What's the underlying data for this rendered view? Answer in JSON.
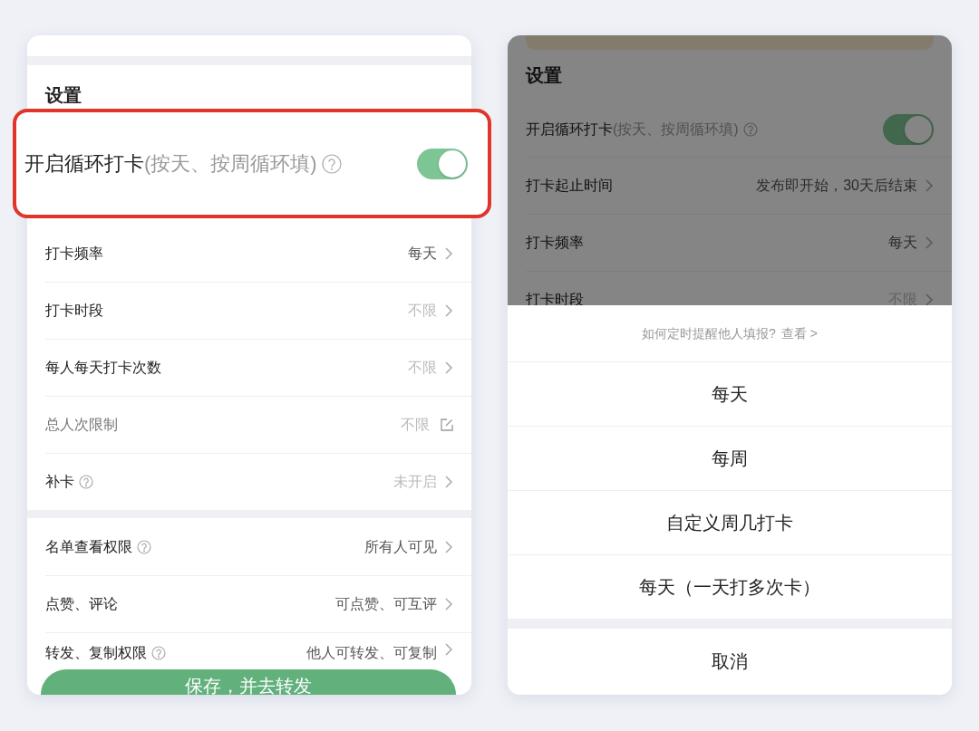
{
  "left_panel": {
    "section_title": "设置",
    "recurring": {
      "label": "开启循环打卡",
      "hint": "(按天、按周循环填)",
      "help": true,
      "on": true,
      "highlighted": true
    },
    "groups": [
      {
        "rows": [
          {
            "label": "打卡频率",
            "value": "每天",
            "kind": "chevron",
            "help": false,
            "value_muted": false,
            "label_muted": false
          },
          {
            "label": "打卡时段",
            "value": "不限",
            "kind": "chevron",
            "help": false,
            "value_muted": true,
            "label_muted": false
          },
          {
            "label": "每人每天打卡次数",
            "value": "不限",
            "kind": "chevron",
            "help": false,
            "value_muted": true,
            "label_muted": false
          },
          {
            "label": "总人次限制",
            "value": "不限",
            "kind": "edit",
            "help": false,
            "value_muted": true,
            "label_muted": true
          },
          {
            "label": "补卡",
            "value": "未开启",
            "kind": "chevron",
            "help": true,
            "value_muted": true,
            "label_muted": false
          }
        ]
      },
      {
        "rows": [
          {
            "label": "名单查看权限",
            "value": "所有人可见",
            "kind": "chevron",
            "help": true,
            "value_muted": false,
            "label_muted": false
          },
          {
            "label": "点赞、评论",
            "value": "可点赞、可互评",
            "kind": "chevron",
            "help": false,
            "value_muted": false,
            "label_muted": false
          },
          {
            "label": "转发、复制权限",
            "value": "他人可转发、可复制",
            "kind": "chevron",
            "help": true,
            "value_muted": false,
            "label_muted": false
          }
        ]
      }
    ],
    "save_button": "保存，并去转发"
  },
  "right_panel": {
    "section_title": "设置",
    "recurring": {
      "label": "开启循环打卡",
      "hint": "(按天、按周循环填)",
      "help": true,
      "on": true
    },
    "rows": [
      {
        "label": "打卡起止时间",
        "value": "发布即开始，30天后结束",
        "value_muted": false
      },
      {
        "label": "打卡频率",
        "value": "每天",
        "value_muted": false
      },
      {
        "label": "打卡时段",
        "value": "不限",
        "value_muted": true
      }
    ],
    "sheet": {
      "hint": "如何定时提醒他人填报?",
      "link": "查看 >",
      "options": [
        "每天",
        "每周",
        "自定义周几打卡",
        "每天（一天打多次卡）"
      ],
      "cancel": "取消"
    }
  }
}
